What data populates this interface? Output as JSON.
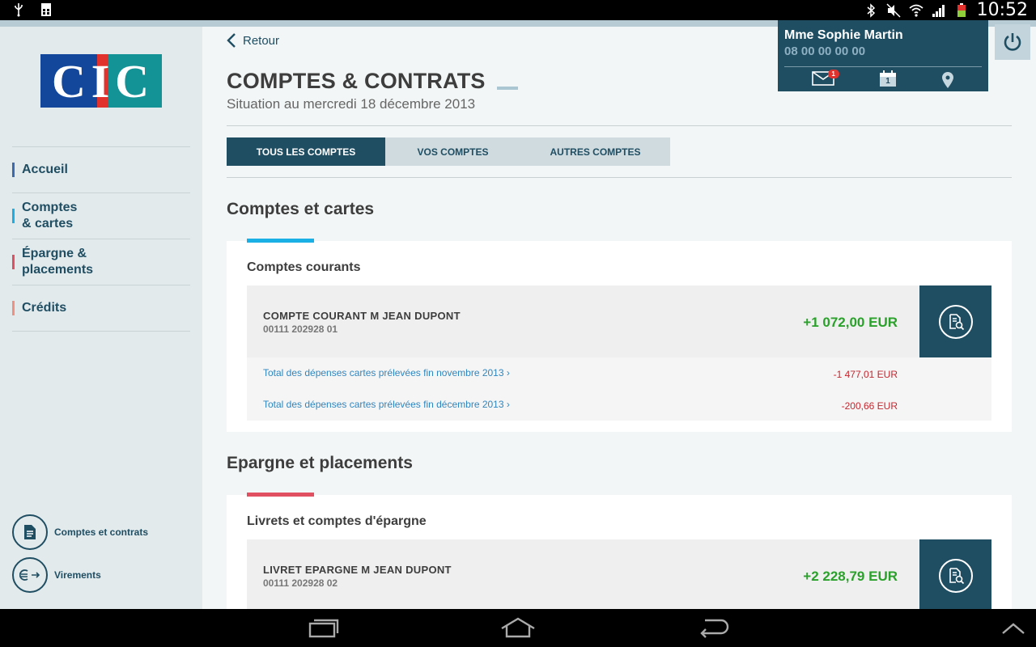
{
  "status_bar": {
    "clock": "10:52",
    "left_icons": [
      "usb-icon",
      "sim-manager-icon"
    ],
    "right_icons": [
      "bluetooth-icon",
      "mute-icon",
      "wifi-icon",
      "signal-icon",
      "battery-icon"
    ]
  },
  "sidebar": {
    "logo_text": "CIC",
    "nav": [
      {
        "label": "Accueil",
        "color": "#3a6bb0"
      },
      {
        "label": "Comptes\n& cartes",
        "line1": "Comptes",
        "line2": "& cartes",
        "color": "#1ab0e6"
      },
      {
        "label": "Épargne & placements",
        "line1": "Épargne &",
        "line2": "placements",
        "color": "#e05060"
      },
      {
        "label": "Crédits",
        "color": "#f09080"
      }
    ],
    "bottom_links": [
      {
        "label": "Comptes et contrats",
        "icon": "document-icon"
      },
      {
        "label": "Virements",
        "icon": "euro-transfer-icon"
      }
    ]
  },
  "header": {
    "back_label": "Retour",
    "title": "COMPTES & CONTRATS",
    "subtitle": "Situation au mercredi 18 décembre 2013"
  },
  "tabs": [
    {
      "label": "TOUS LES COMPTES",
      "active": true
    },
    {
      "label": "VOS COMPTES",
      "active": false
    },
    {
      "label": "AUTRES COMPTES",
      "active": false
    }
  ],
  "profile": {
    "name": "Mme Sophie Martin",
    "phone": "08 00 00 00 00",
    "mail_badge": "1",
    "calendar_day": "1",
    "icons": [
      "mail-icon",
      "calendar-icon",
      "location-icon"
    ]
  },
  "sections": [
    {
      "heading": "Comptes et cartes",
      "card_title": "Comptes courants",
      "stripe_color": "#1ab0e6",
      "account": {
        "name": "COMPTE COURANT M JEAN DUPONT",
        "number": "00111 202928 01",
        "amount": "+1 072,00 EUR"
      },
      "sub_rows": [
        {
          "label": "Total des dépenses cartes prélevées fin novembre 2013",
          "value": "-1 477,01 EUR"
        },
        {
          "label": "Total des dépenses cartes prélevées fin décembre 2013",
          "value": "-200,66 EUR"
        }
      ]
    },
    {
      "heading": "Epargne et placements",
      "card_title": "Livrets et comptes d'épargne",
      "stripe_color": "#e05060",
      "account": {
        "name": "LIVRET EPARGNE M JEAN DUPONT",
        "number": "00111 202928 02",
        "amount": "+2 228,79 EUR"
      }
    }
  ],
  "colors": {
    "primary": "#1f4e63",
    "positive": "#2aa12a",
    "negative": "#c6262e",
    "link": "#2f86bf"
  }
}
